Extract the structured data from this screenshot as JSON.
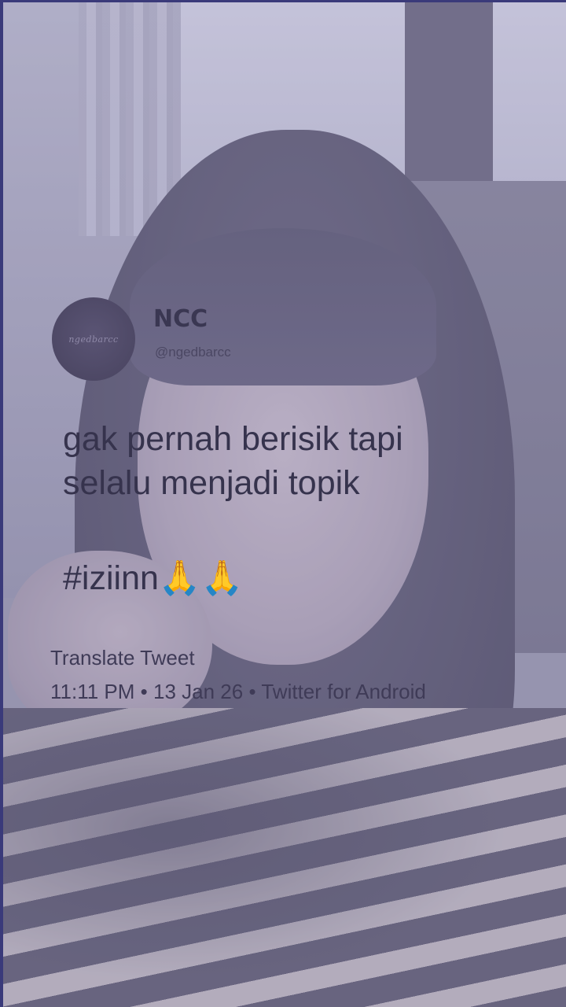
{
  "tweet": {
    "avatar_text": "ngedbarcc",
    "display_name": "NCC",
    "handle": "@ngedbarcc",
    "text_line1": "gak pernah berisik tapi",
    "text_line2": "selalu menjadi topik",
    "hashtag": "#iziinn🙏🙏",
    "translate_label": "Translate Tweet",
    "time": "11:11 PM",
    "separator": "•",
    "date": "13 Jan 26",
    "source": "Twitter for Android"
  },
  "colors": {
    "text_dark": "#36334d",
    "meta_text": "#3f3b57",
    "overlay_tint": "#aaa8c8"
  }
}
